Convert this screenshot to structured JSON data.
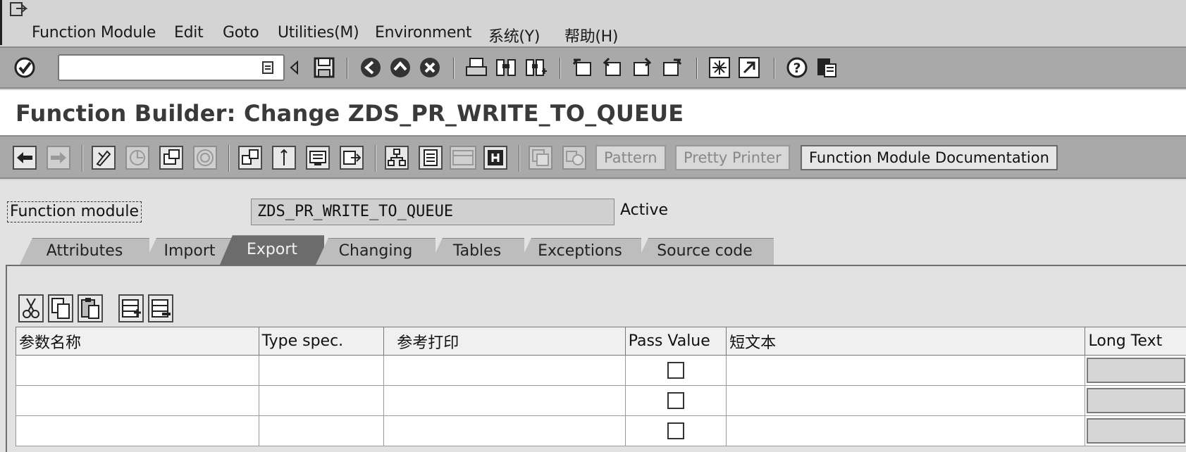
{
  "menu": {
    "items": [
      {
        "label": "Function Module"
      },
      {
        "label": "Edit"
      },
      {
        "label": "Goto"
      },
      {
        "label": "Utilities(M)"
      },
      {
        "label": "Environment"
      },
      {
        "label": "系统(Y)"
      },
      {
        "label": "帮助(H)"
      }
    ]
  },
  "screen": {
    "title": "Function Builder: Change ZDS_PR_WRITE_TO_QUEUE"
  },
  "app_toolbar": {
    "pattern_label": "Pattern",
    "pretty_printer_label": "Pretty Printer",
    "documentation_label": "Function Module Documentation"
  },
  "function_module": {
    "label": "Function module",
    "value": "ZDS_PR_WRITE_TO_QUEUE",
    "status": "Active"
  },
  "tabs": [
    {
      "label": "Attributes"
    },
    {
      "label": "Import"
    },
    {
      "label": "Export"
    },
    {
      "label": "Changing"
    },
    {
      "label": "Tables"
    },
    {
      "label": "Exceptions"
    },
    {
      "label": "Source code"
    }
  ],
  "active_tab": "Export",
  "table": {
    "columns": [
      {
        "label": "参数名称"
      },
      {
        "label": "Type spec."
      },
      {
        "label": "参考打印"
      },
      {
        "label": "Pass Value"
      },
      {
        "label": "短文本"
      },
      {
        "label": "Long Text"
      }
    ],
    "rows": [
      {
        "name": "",
        "type_spec": "",
        "ref": "",
        "pass_value": false,
        "short_text": ""
      },
      {
        "name": "",
        "type_spec": "",
        "ref": "",
        "pass_value": false,
        "short_text": ""
      },
      {
        "name": "",
        "type_spec": "",
        "ref": "",
        "pass_value": false,
        "short_text": ""
      }
    ]
  },
  "icons": {
    "standard_toolbar": [
      "enter-icon",
      "dropdown-icon",
      "back-triangle-icon",
      "save-icon",
      "back-icon",
      "exit-icon",
      "cancel-icon",
      "print-icon",
      "find-icon",
      "find-next-icon",
      "first-page-icon",
      "previous-page-icon",
      "next-page-icon",
      "last-page-icon",
      "new-session-icon",
      "shortcut-icon",
      "help-icon",
      "layout-icon"
    ],
    "app_toolbar": [
      "back-arrow-icon",
      "forward-arrow-icon",
      "display-change-icon",
      "active-inactive-icon",
      "other-object-icon",
      "check-icon",
      "activate-icon",
      "where-used-icon",
      "display-object-list-icon",
      "navigation-window-icon",
      "enhancement-icon",
      "function-module-test-icon",
      "info-icon"
    ],
    "table_tools": [
      "cut-icon",
      "copy-icon",
      "paste-icon",
      "insert-row-icon",
      "delete-row-icon"
    ]
  }
}
